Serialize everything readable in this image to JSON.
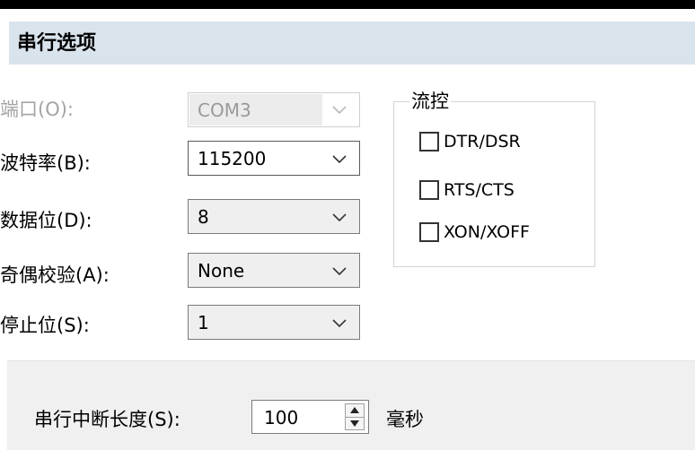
{
  "section": {
    "title": "串行选项"
  },
  "fields": {
    "port": {
      "label": "端口(O):",
      "value": "COM3",
      "enabled": false
    },
    "baud_rate": {
      "label": "波特率(B):",
      "value": "115200"
    },
    "data_bits": {
      "label": "数据位(D):",
      "value": "8"
    },
    "parity": {
      "label": "奇偶校验(A):",
      "value": "None"
    },
    "stop_bits": {
      "label": "停止位(S):",
      "value": "1"
    }
  },
  "flow_control": {
    "legend": "流控",
    "options": [
      {
        "label": "DTR/DSR",
        "checked": false
      },
      {
        "label": "RTS/CTS",
        "checked": false
      },
      {
        "label": "XON/XOFF",
        "checked": false
      }
    ]
  },
  "serial_break": {
    "label": "串行中断长度(S):",
    "value": "100",
    "unit": "毫秒"
  },
  "icons": {
    "dropdown": "chevron-down-icon",
    "spin_up": "arrow-up-icon",
    "spin_down": "arrow-down-icon"
  },
  "colors": {
    "header_background": "#d9e3ec",
    "disabled_text": "#a4a4a4",
    "panel_background": "#f0f0f0"
  }
}
